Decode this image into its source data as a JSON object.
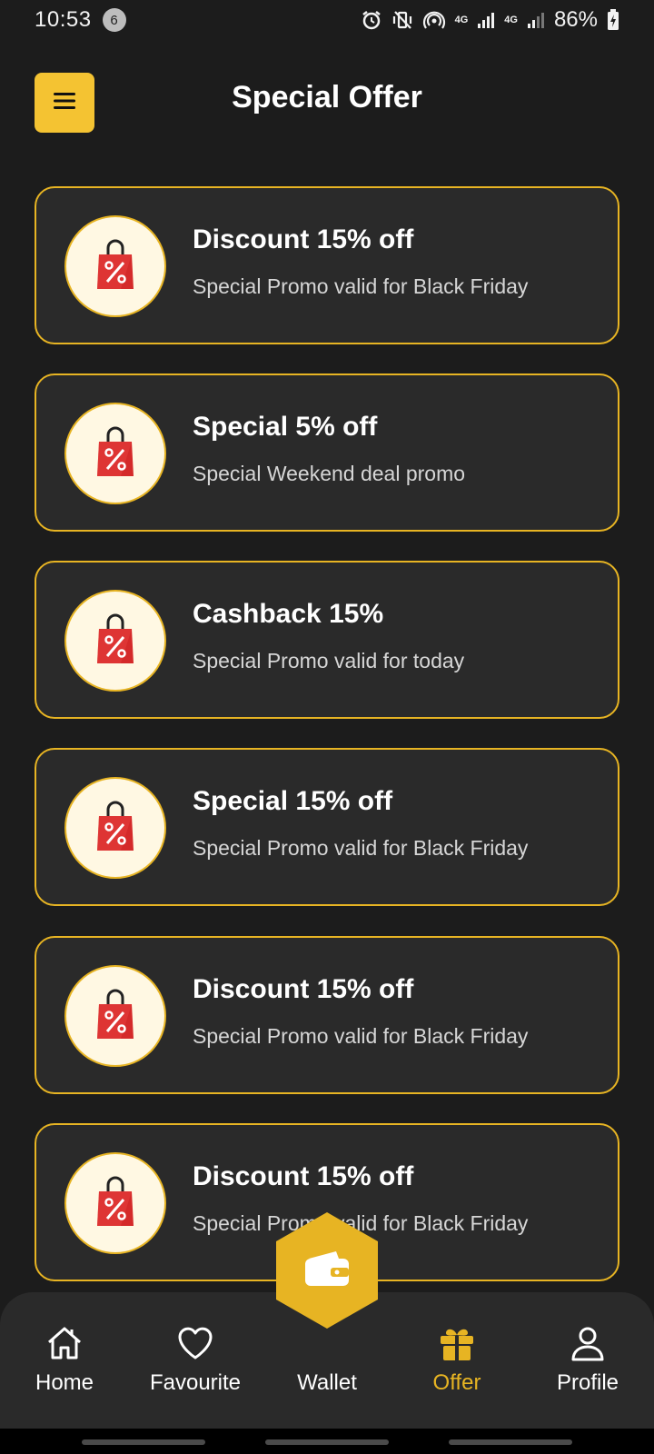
{
  "status_bar": {
    "time": "10:53",
    "notification_count": "6",
    "network_label_1": "4G",
    "network_label_2": "4G",
    "battery": "86%",
    "icons": [
      "alarm-icon",
      "vibrate-off-icon",
      "hotspot-icon",
      "signal-icon",
      "signal-icon",
      "battery-charging-icon"
    ]
  },
  "header": {
    "title": "Special Offer",
    "menu_icon": "hamburger-menu-icon"
  },
  "offers": [
    {
      "title": "Discount 15% off",
      "subtitle": "Special Promo valid for Black Friday",
      "icon": "shopping-bag-percent-icon"
    },
    {
      "title": "Special 5% off",
      "subtitle": "Special Weekend deal promo",
      "icon": "shopping-bag-percent-icon"
    },
    {
      "title": "Cashback 15%",
      "subtitle": "Special Promo valid for today",
      "icon": "shopping-bag-percent-icon"
    },
    {
      "title": "Special 15% off",
      "subtitle": "Special Promo valid for Black Friday",
      "icon": "shopping-bag-percent-icon"
    },
    {
      "title": "Discount 15% off",
      "subtitle": "Special Promo valid for Black Friday",
      "icon": "shopping-bag-percent-icon"
    },
    {
      "title": "Discount 15% off",
      "subtitle": "Special Promo valid for Black Friday",
      "icon": "shopping-bag-percent-icon"
    }
  ],
  "bottom_nav": {
    "items": [
      {
        "label": "Home",
        "icon": "home-icon",
        "active": false
      },
      {
        "label": "Favourite",
        "icon": "heart-icon",
        "active": false
      },
      {
        "label": "Wallet",
        "icon": "wallet-icon",
        "active": false
      },
      {
        "label": "Offer",
        "icon": "gift-icon",
        "active": true
      },
      {
        "label": "Profile",
        "icon": "user-icon",
        "active": false
      }
    ]
  },
  "colors": {
    "background": "#1c1c1c",
    "card": "#2a2a2a",
    "accent": "#e7b423",
    "menu_button": "#f4c332",
    "icon_circle": "#fff8e3",
    "bag_red": "#d42a2a"
  }
}
